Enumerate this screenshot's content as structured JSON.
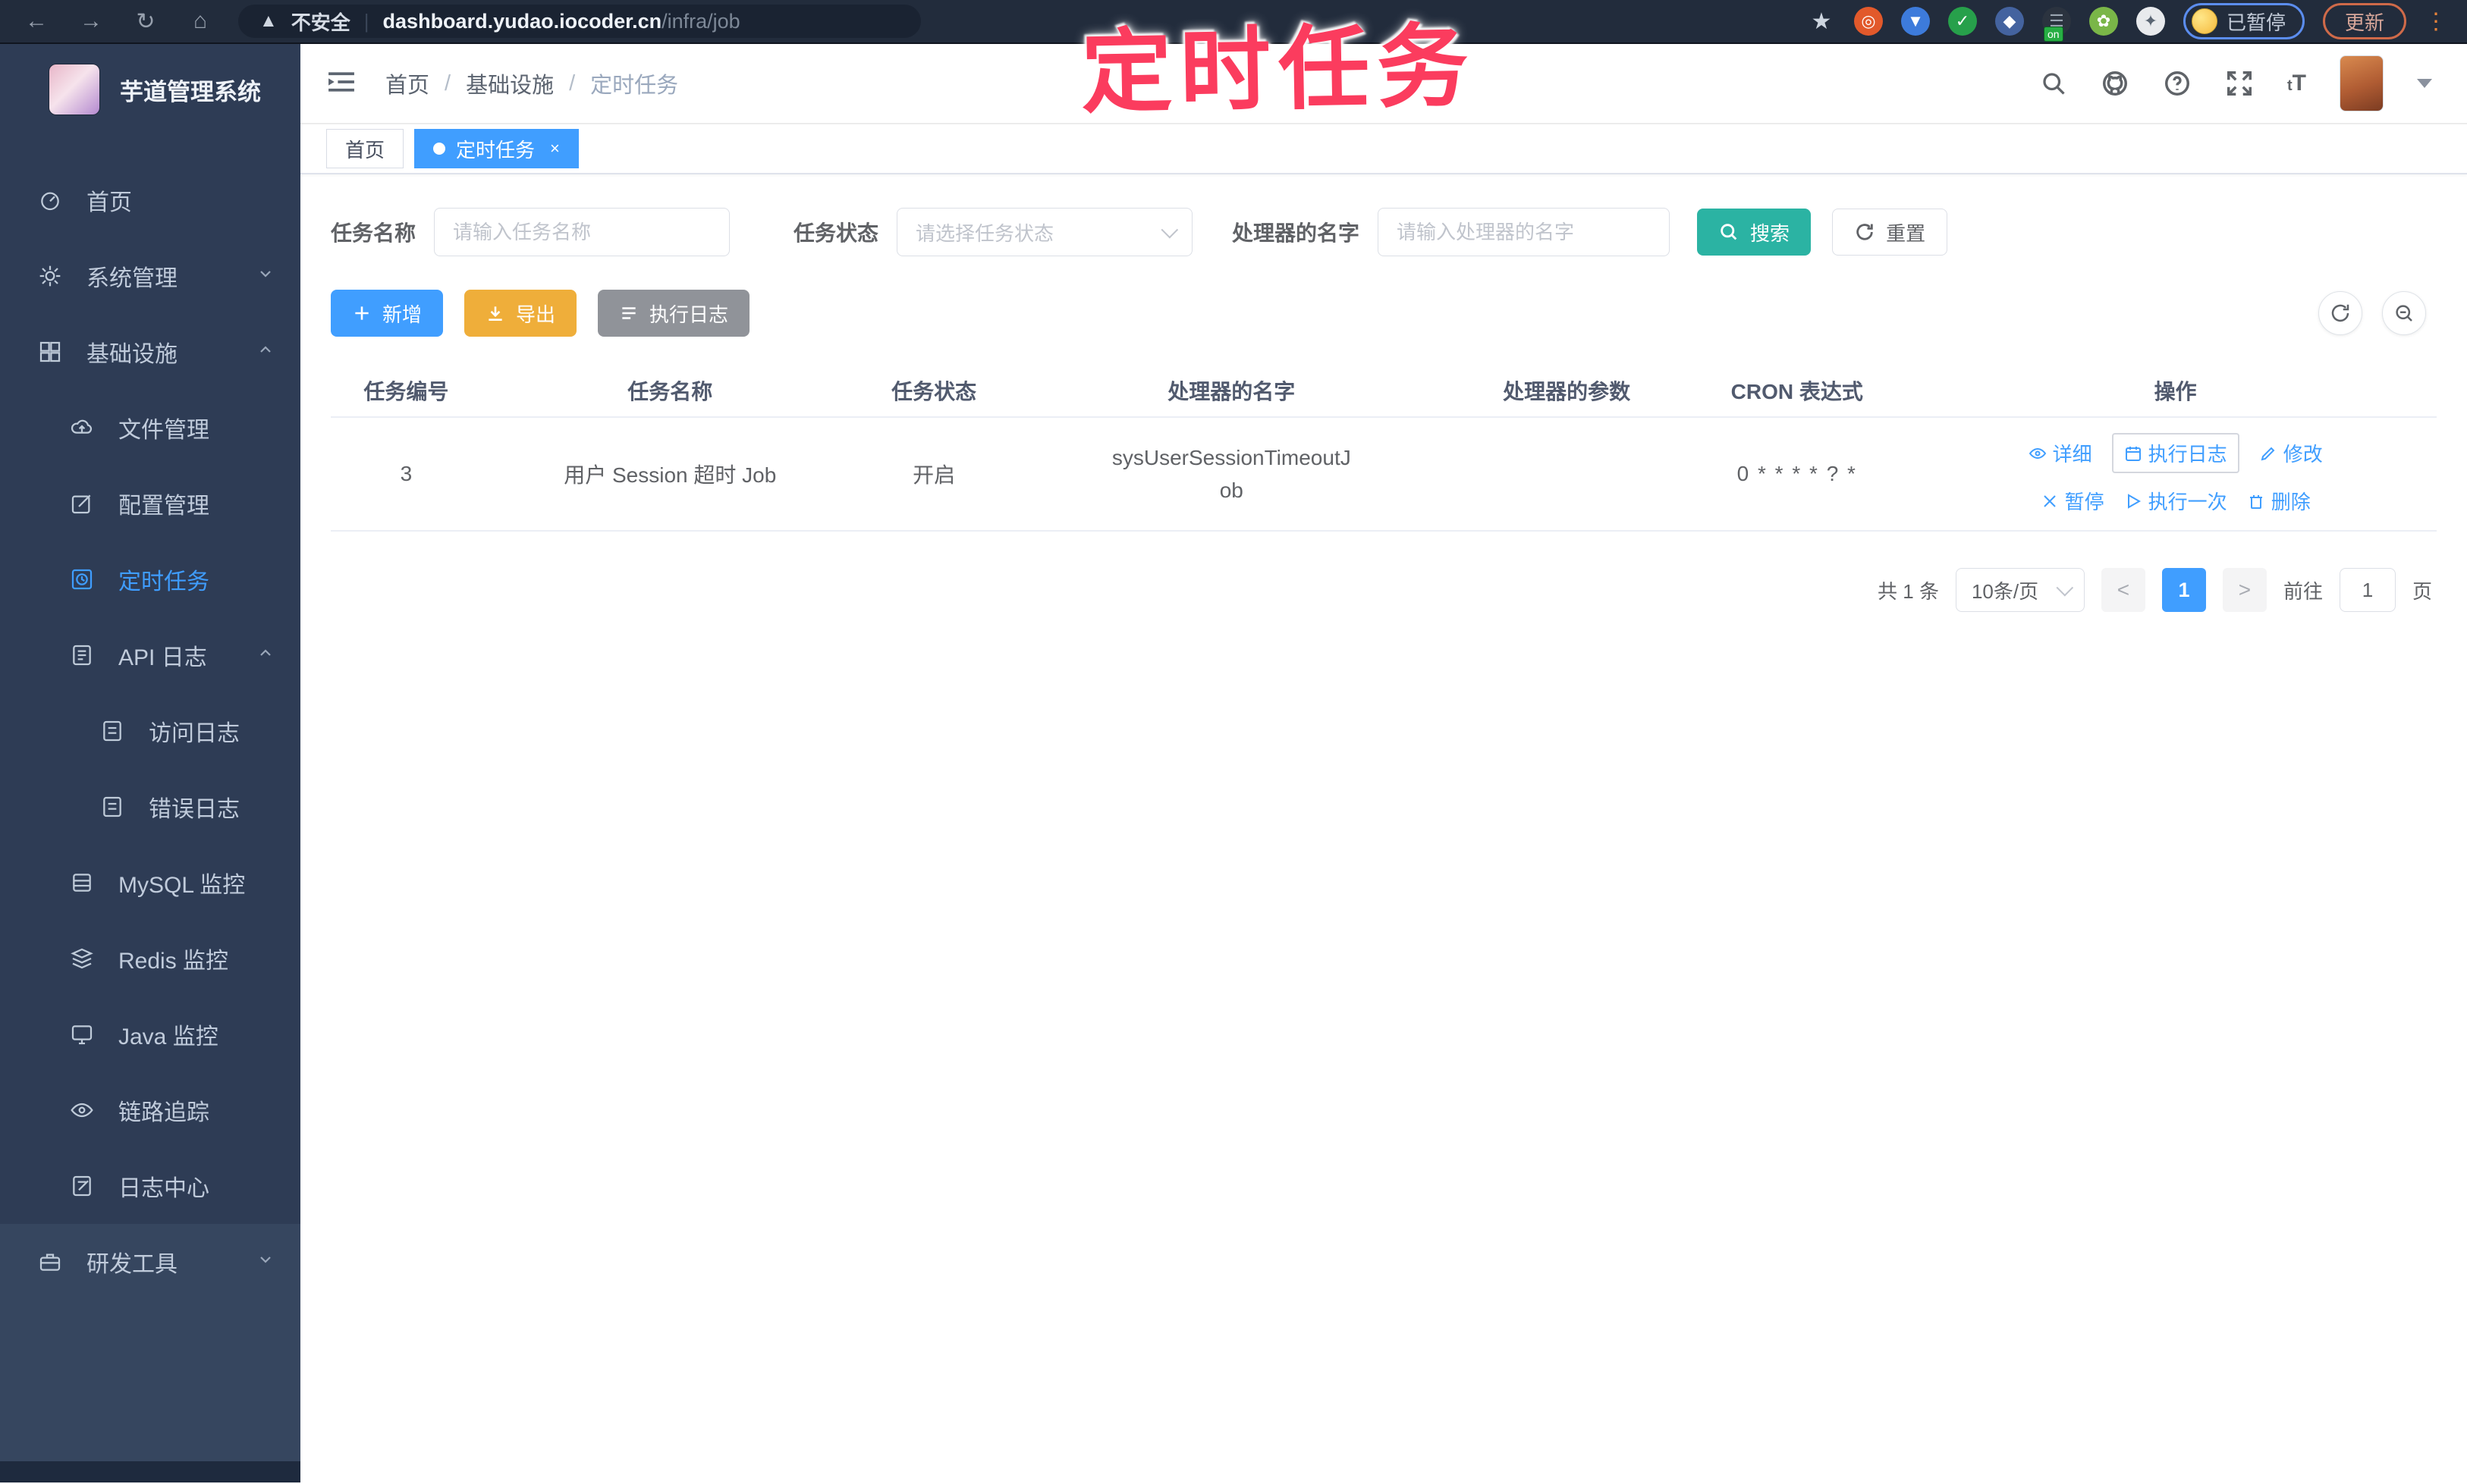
{
  "annotation": {
    "label": "定时任务"
  },
  "browser": {
    "security_label": "不安全",
    "url_host": "dashboard.yudao.iocoder.cn",
    "url_path": "/infra/job",
    "extension_badge": "on",
    "paused_label": "已暂停",
    "update_label": "更新"
  },
  "sidebar": {
    "title": "芋道管理系统",
    "items": [
      {
        "label": "首页"
      },
      {
        "label": "系统管理"
      },
      {
        "label": "基础设施"
      },
      {
        "label": "文件管理"
      },
      {
        "label": "配置管理"
      },
      {
        "label": "定时任务"
      },
      {
        "label": "API 日志"
      },
      {
        "label": "访问日志"
      },
      {
        "label": "错误日志"
      },
      {
        "label": "MySQL 监控"
      },
      {
        "label": "Redis 监控"
      },
      {
        "label": "Java 监控"
      },
      {
        "label": "链路追踪"
      },
      {
        "label": "日志中心"
      },
      {
        "label": "研发工具"
      }
    ]
  },
  "header": {
    "breadcrumb": [
      "首页",
      "基础设施",
      "定时任务"
    ],
    "separator": "/"
  },
  "tabs": [
    {
      "label": "首页"
    },
    {
      "label": "定时任务",
      "close": "×"
    }
  ],
  "filters": {
    "name_label": "任务名称",
    "name_placeholder": "请输入任务名称",
    "status_label": "任务状态",
    "status_placeholder": "请选择任务状态",
    "handler_label": "处理器的名字",
    "handler_placeholder": "请输入处理器的名字",
    "search_label": "搜索",
    "reset_label": "重置"
  },
  "toolbar": {
    "add_label": "新增",
    "export_label": "导出",
    "log_label": "执行日志"
  },
  "table": {
    "headers": [
      "任务编号",
      "任务名称",
      "任务状态",
      "处理器的名字",
      "处理器的参数",
      "CRON 表达式",
      "操作"
    ],
    "rows": [
      {
        "id": "3",
        "name": "用户 Session 超时 Job",
        "status": "开启",
        "handler": "sysUserSessionTimeoutJob",
        "param": "",
        "cron": "0 * * * * ? *",
        "actions": [
          "详细",
          "执行日志",
          "修改",
          "暂停",
          "执行一次",
          "删除"
        ]
      }
    ]
  },
  "pagination": {
    "total": "共 1 条",
    "page_size": "10条/页",
    "prev": "<",
    "next": ">",
    "page": "1",
    "goto_label": "前往",
    "goto_value": "1",
    "unit_label": "页"
  },
  "colors": {
    "accent": "#409eff",
    "search_button": "#2bb3a3",
    "export_button": "#efae3a",
    "info_button": "#909399",
    "annotation": "#fb3c5e",
    "sidebar_bg": "#2e3c55"
  }
}
